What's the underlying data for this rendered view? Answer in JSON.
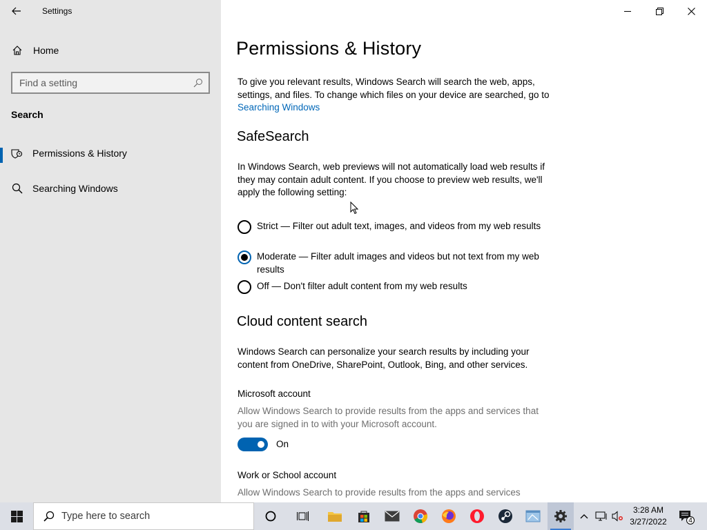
{
  "window": {
    "app_title": "Settings"
  },
  "sidebar": {
    "home_label": "Home",
    "search_placeholder": "Find a setting",
    "section_label": "Search",
    "items": [
      {
        "label": "Permissions & History",
        "selected": true,
        "icon": "permissions-shield-icon"
      },
      {
        "label": "Searching Windows",
        "selected": false,
        "icon": "search-icon"
      }
    ]
  },
  "main": {
    "title": "Permissions & History",
    "intro_text": "To give you relevant results, Windows Search will search the web, apps, settings, and files. To change which files on your device are searched, go to ",
    "intro_link": "Searching Windows",
    "safesearch": {
      "heading": "SafeSearch",
      "description": "In Windows Search, web previews will not automatically load web results if they may contain adult content. If you choose to preview web results, we'll apply the following setting:",
      "options": [
        {
          "label": "Strict — Filter out adult text, images, and videos from my web results",
          "checked": false
        },
        {
          "label": "Moderate — Filter adult images and videos but not text from my web results",
          "checked": true
        },
        {
          "label": "Off — Don't filter adult content from my web results",
          "checked": false
        }
      ]
    },
    "cloud": {
      "heading": "Cloud content search",
      "description": "Windows Search can personalize your search results by including your content from OneDrive, SharePoint, Outlook, Bing, and other services.",
      "microsoft_account": {
        "title": "Microsoft account",
        "description": "Allow Windows Search to provide results from the apps and services that you are signed in to with your Microsoft account.",
        "toggle_state": "On"
      },
      "work_account": {
        "title": "Work or School account",
        "description": "Allow Windows Search to provide results from the apps and services"
      }
    }
  },
  "taskbar": {
    "search_placeholder": "Type here to search",
    "time": "3:28 AM",
    "date": "3/27/2022",
    "notification_count": "4",
    "accent_color": "#0063b1"
  }
}
